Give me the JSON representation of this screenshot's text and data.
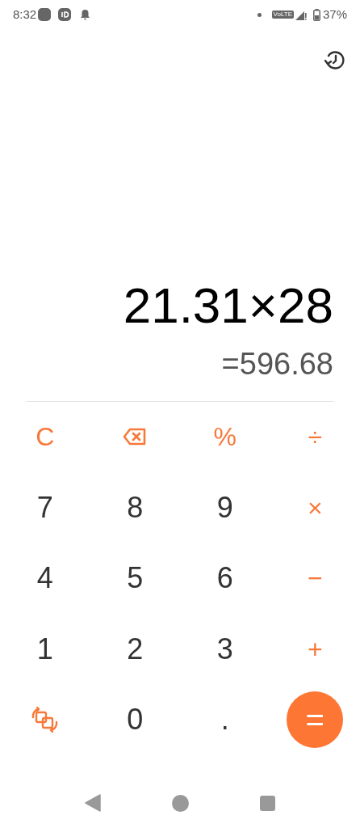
{
  "status_bar": {
    "time": "8:32",
    "network": "VoLTE",
    "battery": "37%"
  },
  "display": {
    "expression": "21.31×28",
    "result": "=596.68"
  },
  "keys": [
    {
      "kind": "function",
      "label": "C"
    },
    {
      "kind": "backspace"
    },
    {
      "kind": "function",
      "label": "%"
    },
    {
      "kind": "function",
      "label": "÷"
    },
    {
      "kind": "digit",
      "label": "7"
    },
    {
      "kind": "digit",
      "label": "8"
    },
    {
      "kind": "digit",
      "label": "9"
    },
    {
      "kind": "function",
      "label": "×"
    },
    {
      "kind": "digit",
      "label": "4"
    },
    {
      "kind": "digit",
      "label": "5"
    },
    {
      "kind": "digit",
      "label": "6"
    },
    {
      "kind": "function",
      "label": "−"
    },
    {
      "kind": "digit",
      "label": "1"
    },
    {
      "kind": "digit",
      "label": "2"
    },
    {
      "kind": "digit",
      "label": "3"
    },
    {
      "kind": "function",
      "label": "+"
    },
    {
      "kind": "convert"
    },
    {
      "kind": "digit",
      "label": "0"
    },
    {
      "kind": "digit",
      "label": "."
    },
    {
      "kind": "equals",
      "label": "="
    }
  ]
}
